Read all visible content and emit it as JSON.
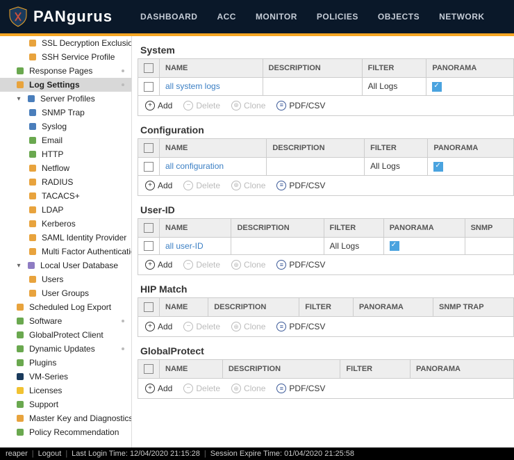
{
  "brand": "PANgurus",
  "nav": [
    "DASHBOARD",
    "ACC",
    "MONITOR",
    "POLICIES",
    "OBJECTS",
    "NETWORK"
  ],
  "sidebar": {
    "items": [
      {
        "label": "SSL Decryption Exclusion",
        "indent": 2,
        "icon": "file-orange"
      },
      {
        "label": "SSH Service Profile",
        "indent": 2,
        "icon": "file-orange"
      },
      {
        "label": "Response Pages",
        "indent": 1,
        "icon": "page-green",
        "dot": true
      },
      {
        "label": "Log Settings",
        "indent": 1,
        "icon": "log-orange",
        "dot": true,
        "selected": true
      },
      {
        "label": "Server Profiles",
        "indent": 1,
        "icon": "folder-blue",
        "caret": "down"
      },
      {
        "label": "SNMP Trap",
        "indent": 2,
        "icon": "doc-blue"
      },
      {
        "label": "Syslog",
        "indent": 2,
        "icon": "doc-blue"
      },
      {
        "label": "Email",
        "indent": 2,
        "icon": "mail-green"
      },
      {
        "label": "HTTP",
        "indent": 2,
        "icon": "http-green"
      },
      {
        "label": "Netflow",
        "indent": 2,
        "icon": "flow-orange"
      },
      {
        "label": "RADIUS",
        "indent": 2,
        "icon": "lock-orange"
      },
      {
        "label": "TACACS+",
        "indent": 2,
        "icon": "lock-orange"
      },
      {
        "label": "LDAP",
        "indent": 2,
        "icon": "lock-orange"
      },
      {
        "label": "Kerberos",
        "indent": 2,
        "icon": "lock-orange"
      },
      {
        "label": "SAML Identity Provider",
        "indent": 2,
        "icon": "lock-orange"
      },
      {
        "label": "Multi Factor Authentication",
        "indent": 2,
        "icon": "lock-orange"
      },
      {
        "label": "Local User Database",
        "indent": 1,
        "icon": "db-purple",
        "caret": "down"
      },
      {
        "label": "Users",
        "indent": 2,
        "icon": "user-orange"
      },
      {
        "label": "User Groups",
        "indent": 2,
        "icon": "users-orange"
      },
      {
        "label": "Scheduled Log Export",
        "indent": 1,
        "icon": "sched-orange"
      },
      {
        "label": "Software",
        "indent": 1,
        "icon": "cog-green",
        "dot": true
      },
      {
        "label": "GlobalProtect Client",
        "indent": 1,
        "icon": "globe-green"
      },
      {
        "label": "Dynamic Updates",
        "indent": 1,
        "icon": "update-green",
        "dot": true
      },
      {
        "label": "Plugins",
        "indent": 1,
        "icon": "puzzle-green"
      },
      {
        "label": "VM-Series",
        "indent": 1,
        "icon": "vm-blue"
      },
      {
        "label": "Licenses",
        "indent": 1,
        "icon": "key-yellow"
      },
      {
        "label": "Support",
        "indent": 1,
        "icon": "support-green"
      },
      {
        "label": "Master Key and Diagnostics",
        "indent": 1,
        "icon": "key-orange"
      },
      {
        "label": "Policy Recommendation",
        "indent": 1,
        "icon": "policy-green"
      }
    ]
  },
  "sections": [
    {
      "title": "System",
      "cols": [
        "NAME",
        "DESCRIPTION",
        "FILTER",
        "PANORAMA"
      ],
      "rows": [
        {
          "name": "all system logs",
          "description": "",
          "filter": "All Logs",
          "panorama": true
        }
      ],
      "toolbar": {
        "add": "Add",
        "delete": "Delete",
        "clone": "Clone",
        "pdf": "PDF/CSV"
      }
    },
    {
      "title": "Configuration",
      "cols": [
        "NAME",
        "DESCRIPTION",
        "FILTER",
        "PANORAMA"
      ],
      "rows": [
        {
          "name": "all configuration",
          "description": "",
          "filter": "All Logs",
          "panorama": true
        }
      ],
      "toolbar": {
        "add": "Add",
        "delete": "Delete",
        "clone": "Clone",
        "pdf": "PDF/CSV"
      }
    },
    {
      "title": "User-ID",
      "cols": [
        "NAME",
        "DESCRIPTION",
        "FILTER",
        "PANORAMA",
        "SNMP"
      ],
      "rows": [
        {
          "name": "all user-ID",
          "description": "",
          "filter": "All Logs",
          "panorama": true,
          "snmp": ""
        }
      ],
      "toolbar": {
        "add": "Add",
        "delete": "Delete",
        "clone": "Clone",
        "pdf": "PDF/CSV"
      }
    },
    {
      "title": "HIP Match",
      "cols": [
        "NAME",
        "DESCRIPTION",
        "FILTER",
        "PANORAMA",
        "SNMP TRAP"
      ],
      "rows": [],
      "toolbar": {
        "add": "Add",
        "delete": "Delete",
        "clone": "Clone",
        "pdf": "PDF/CSV"
      }
    },
    {
      "title": "GlobalProtect",
      "cols": [
        "NAME",
        "DESCRIPTION",
        "FILTER",
        "PANORAMA"
      ],
      "rows": [],
      "toolbar": {
        "add": "Add",
        "delete": "Delete",
        "clone": "Clone",
        "pdf": "PDF/CSV"
      }
    }
  ],
  "footer": {
    "user": "reaper",
    "logout": "Logout",
    "last_login": "Last Login Time: 12/04/2020 21:15:28",
    "session_expire": "Session Expire Time: 01/04/2020 21:25:58"
  }
}
